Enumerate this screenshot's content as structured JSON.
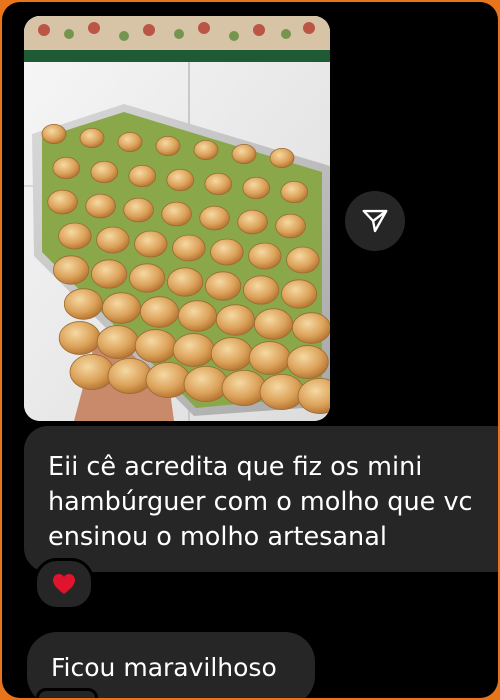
{
  "conversation": {
    "messages": [
      {
        "text": "Eii cê acredita que fiz os mini hambúrguer com o molho que vc ensinou o molho artesanal",
        "reaction": "❤️"
      },
      {
        "text": "Ficou maravilhoso"
      }
    ]
  },
  "icons": {
    "share": "paper-plane-icon",
    "reaction": "heart-icon"
  },
  "colors": {
    "background": "#000000",
    "bubble": "#262626",
    "text": "#ffffff",
    "reaction_heart": "#e0142c",
    "outer_border": "#e8741c"
  }
}
